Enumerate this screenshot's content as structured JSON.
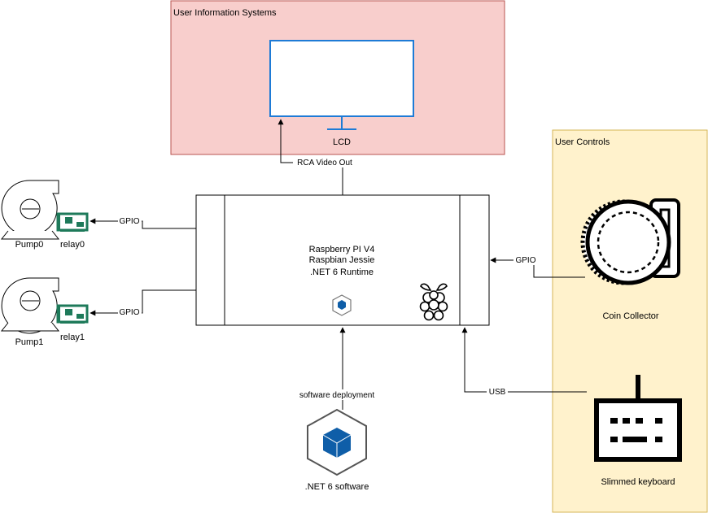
{
  "groups": {
    "user_info": {
      "title": "User Information Systems",
      "fill": "#f8cecc",
      "stroke": "#b85450"
    },
    "user_controls": {
      "title": "User Controls",
      "fill": "#fff2cc",
      "stroke": "#d6b656"
    }
  },
  "devices": {
    "lcd": {
      "label": "LCD",
      "color": "#1e7bd6"
    },
    "pi": {
      "line1": "Raspberry PI V4",
      "line2": "Raspbian Jessie",
      "line3": ".NET 6 Runtime"
    },
    "pump0": {
      "label": "Pump0"
    },
    "pump1": {
      "label": "Pump1"
    },
    "relay0": {
      "label": "relay0",
      "color": "#1e7a5a"
    },
    "relay1": {
      "label": "relay1",
      "color": "#1e7a5a"
    },
    "coin": {
      "label": "Coin Collector"
    },
    "keyboard": {
      "label": "Slimmed keyboard"
    },
    "software": {
      "label": ".NET 6 software",
      "color": "#0f5ea8"
    }
  },
  "connections": {
    "rca": "RCA Video Out",
    "gpio_relay0": "GPIO",
    "gpio_relay1": "GPIO",
    "gpio_coin": "GPIO",
    "usb": "USB",
    "deploy": "software deployment"
  }
}
